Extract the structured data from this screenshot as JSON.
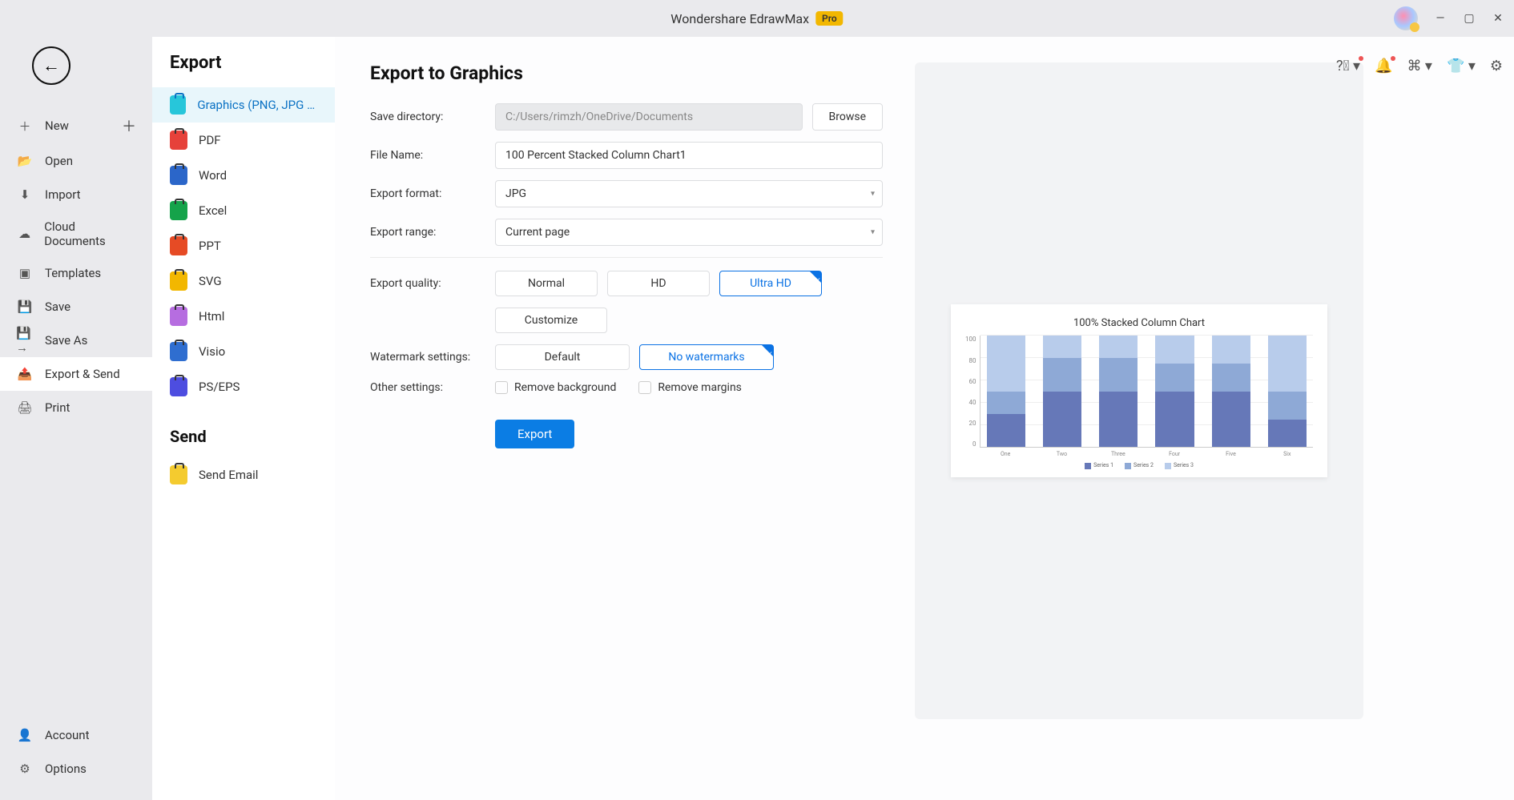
{
  "titlebar": {
    "app": "Wondershare EdrawMax",
    "badge": "Pro"
  },
  "nav": {
    "items": [
      {
        "icon": "add",
        "label": "New",
        "plus": true
      },
      {
        "icon": "folder",
        "label": "Open"
      },
      {
        "icon": "import",
        "label": "Import"
      },
      {
        "icon": "cloud",
        "label": "Cloud Documents"
      },
      {
        "icon": "templates",
        "label": "Templates"
      },
      {
        "icon": "save",
        "label": "Save"
      },
      {
        "icon": "saveas",
        "label": "Save As"
      },
      {
        "icon": "export",
        "label": "Export & Send",
        "selected": true
      },
      {
        "icon": "print",
        "label": "Print"
      }
    ],
    "footer": [
      {
        "icon": "account",
        "label": "Account"
      },
      {
        "icon": "options",
        "label": "Options"
      }
    ]
  },
  "formats": {
    "heading": "Export",
    "items": [
      {
        "cls": "fmt-graphics",
        "label": "Graphics (PNG, JPG et...",
        "selected": true
      },
      {
        "cls": "fmt-pdf",
        "label": "PDF"
      },
      {
        "cls": "fmt-word",
        "label": "Word"
      },
      {
        "cls": "fmt-excel",
        "label": "Excel"
      },
      {
        "cls": "fmt-ppt",
        "label": "PPT"
      },
      {
        "cls": "fmt-svg",
        "label": "SVG"
      },
      {
        "cls": "fmt-html",
        "label": "Html"
      },
      {
        "cls": "fmt-visio",
        "label": "Visio"
      },
      {
        "cls": "fmt-ps",
        "label": "PS/EPS"
      }
    ],
    "send_heading": "Send",
    "send_items": [
      {
        "cls": "fmt-email",
        "label": "Send Email"
      }
    ]
  },
  "form": {
    "title": "Export to Graphics",
    "save_dir_lbl": "Save directory:",
    "save_dir": "C:/Users/rimzh/OneDrive/Documents",
    "browse": "Browse",
    "filename_lbl": "File Name:",
    "filename": "100 Percent Stacked Column Chart1",
    "format_lbl": "Export format:",
    "format": "JPG",
    "range_lbl": "Export range:",
    "range": "Current page",
    "quality_lbl": "Export quality:",
    "quality_opts": [
      "Normal",
      "HD",
      "Ultra HD"
    ],
    "quality_sel": 2,
    "customize": "Customize",
    "wm_lbl": "Watermark settings:",
    "wm_opts": [
      "Default",
      "No watermarks"
    ],
    "wm_sel": 1,
    "other_lbl": "Other settings:",
    "remove_bg": "Remove background",
    "remove_margins": "Remove margins",
    "export_btn": "Export"
  },
  "chart_data": {
    "type": "bar",
    "stacked": true,
    "title": "100% Stacked Column Chart",
    "categories": [
      "One",
      "Two",
      "Three",
      "Four",
      "Five",
      "Six"
    ],
    "yticks": [
      0,
      20,
      40,
      60,
      80,
      100
    ],
    "series": [
      {
        "name": "Series 1",
        "color": "#6678b8",
        "values": [
          30,
          50,
          50,
          50,
          50,
          25
        ]
      },
      {
        "name": "Series 2",
        "color": "#8ea9d6",
        "values": [
          20,
          30,
          30,
          25,
          25,
          25
        ]
      },
      {
        "name": "Series 3",
        "color": "#b8cceb",
        "values": [
          50,
          20,
          20,
          25,
          25,
          50
        ]
      }
    ],
    "ylim": [
      0,
      100
    ]
  }
}
